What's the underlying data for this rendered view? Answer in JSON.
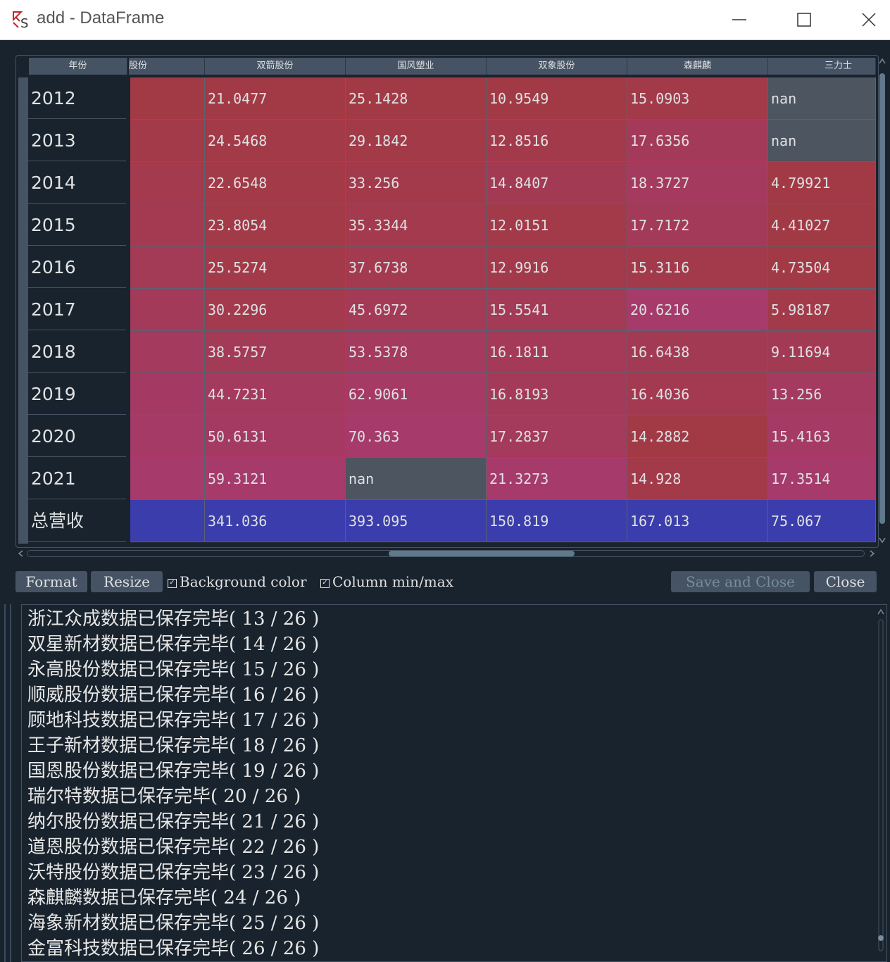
{
  "window": {
    "title": "add - DataFrame",
    "icon": "spyder-icon"
  },
  "table": {
    "index_header": "年份",
    "columns": [
      "股份",
      "双箭股份",
      "国风塑业",
      "双象股份",
      "森麒麟",
      "三力士"
    ],
    "rows": [
      {
        "label": "2012",
        "cells": [
          "",
          "21.0477",
          "25.1428",
          "10.9549",
          "15.0903",
          "nan"
        ]
      },
      {
        "label": "2013",
        "cells": [
          "",
          "24.5468",
          "29.1842",
          "12.8516",
          "17.6356",
          "nan"
        ]
      },
      {
        "label": "2014",
        "cells": [
          "",
          "22.6548",
          "33.256",
          "14.8407",
          "18.3727",
          "4.79921"
        ]
      },
      {
        "label": "2015",
        "cells": [
          "",
          "23.8054",
          "35.3344",
          "12.0151",
          "17.7172",
          "4.41027"
        ]
      },
      {
        "label": "2016",
        "cells": [
          "",
          "25.5274",
          "37.6738",
          "12.9916",
          "15.3116",
          "4.73504"
        ]
      },
      {
        "label": "2017",
        "cells": [
          "",
          "30.2296",
          "45.6972",
          "15.5541",
          "20.6216",
          "5.98187"
        ]
      },
      {
        "label": "2018",
        "cells": [
          "",
          "38.5757",
          "53.5378",
          "16.1811",
          "16.6438",
          "9.11694"
        ]
      },
      {
        "label": "2019",
        "cells": [
          "",
          "44.7231",
          "62.9061",
          "16.8193",
          "16.4036",
          "13.256"
        ]
      },
      {
        "label": "2020",
        "cells": [
          "",
          "50.6131",
          "70.363",
          "17.2837",
          "14.2882",
          "15.4163"
        ]
      },
      {
        "label": "2021",
        "cells": [
          "",
          "59.3121",
          "nan",
          "21.3273",
          "14.928",
          "17.3514"
        ]
      },
      {
        "label": "总营收",
        "cells": [
          "",
          "341.036",
          "393.095",
          "150.819",
          "167.013",
          "75.067"
        ]
      }
    ],
    "colors": {
      "nan": "#4d5561",
      "total": "#3a3dab",
      "ramp_low": "#a23a45",
      "ramp_high": "#a53a6b"
    }
  },
  "toolbar": {
    "format_label": "Format",
    "resize_label": "Resize",
    "bgcolor_label": "Background color",
    "bgcolor_checked": true,
    "colminmax_label": "Column min/max",
    "colminmax_checked": true,
    "save_close_label": "Save and Close",
    "close_label": "Close"
  },
  "console": {
    "lines": [
      "浙江众成数据已保存完毕( 13 / 26 )",
      "双星新材数据已保存完毕( 14 / 26 )",
      "永高股份数据已保存完毕( 15 / 26 )",
      "顺威股份数据已保存完毕( 16 / 26 )",
      "顾地科技数据已保存完毕( 17 / 26 )",
      "王子新材数据已保存完毕( 18 / 26 )",
      "国恩股份数据已保存完毕( 19 / 26 )",
      "瑞尔特数据已保存完毕( 20 / 26 )",
      "纳尔股份数据已保存完毕( 21 / 26 )",
      "道恩股份数据已保存完毕( 22 / 26 )",
      "沃特股份数据已保存完毕( 23 / 26 )",
      "森麒麟数据已保存完毕( 24 / 26 )",
      "海象新材数据已保存完毕( 25 / 26 )",
      "金富科技数据已保存完毕( 26 / 26 )"
    ]
  }
}
